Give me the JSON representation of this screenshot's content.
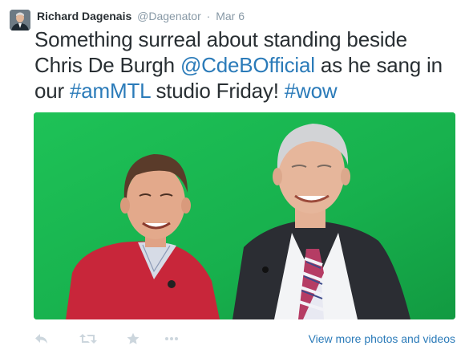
{
  "tweet": {
    "author_name": "Richard Dagenais",
    "author_handle": "@Dagenator",
    "separator": "·",
    "date": "Mar 6",
    "text_parts": {
      "t1": "Something surreal about standing beside Chris De Burgh ",
      "mention": "@CdeBOfficial",
      "t2": " as he sang in our ",
      "hashtag1": "#amMTL",
      "t3": " studio Friday! ",
      "hashtag2": "#wow"
    },
    "view_more_label": "View more photos and videos"
  },
  "icons": {
    "reply": "reply-icon",
    "retweet": "retweet-icon",
    "favorite": "star-icon",
    "more": "more-dots-icon"
  },
  "colors": {
    "link": "#2b7bb9",
    "meta": "#8899a6",
    "icon": "#ccd6dd",
    "green_screen": "#17b04d"
  }
}
